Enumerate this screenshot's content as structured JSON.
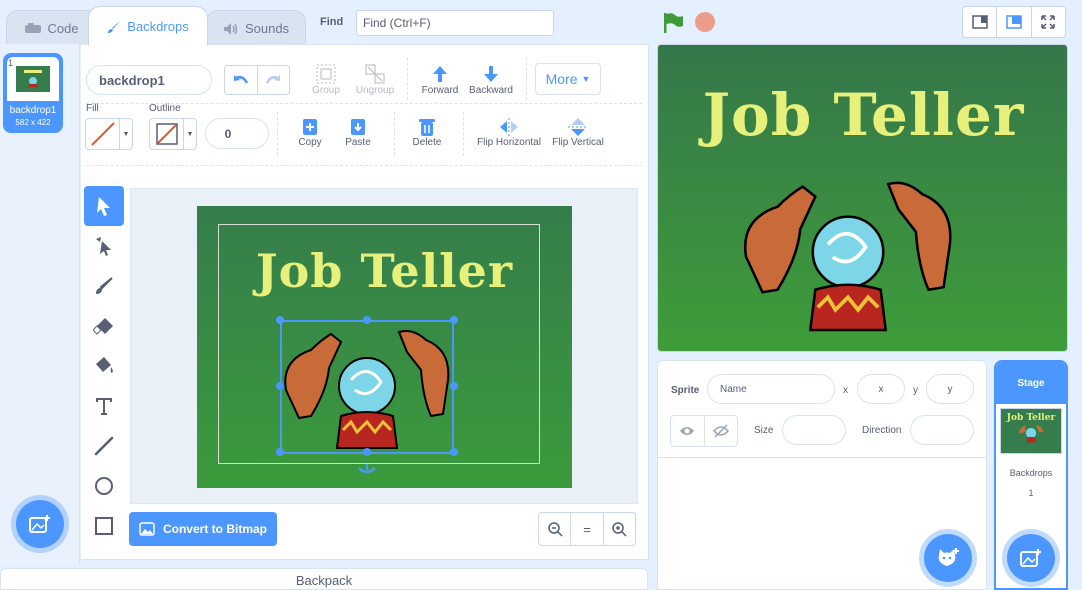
{
  "tabs": {
    "code": "Code",
    "backdrops": "Backdrops",
    "sounds": "Sounds"
  },
  "find": {
    "label": "Find",
    "placeholder": "Find (Ctrl+F)"
  },
  "backdrop_list": [
    {
      "index": "1",
      "name": "backdrop1",
      "size": "582 x 422"
    }
  ],
  "art": {
    "title": "Job Teller"
  },
  "paint": {
    "name_value": "backdrop1",
    "group": "Group",
    "ungroup": "Ungroup",
    "forward": "Forward",
    "backward": "Backward",
    "more": "More",
    "fill_label": "Fill",
    "outline_label": "Outline",
    "outline_width": "0",
    "copy": "Copy",
    "paste": "Paste",
    "delete": "Delete",
    "flip_h": "Flip Horizontal",
    "flip_v": "Flip Vertical",
    "convert": "Convert to Bitmap",
    "zoom_reset": "="
  },
  "backpack": "Backpack",
  "sprite_info": {
    "sprite_label": "Sprite",
    "name_placeholder": "Name",
    "x_label": "x",
    "x_placeholder": "x",
    "y_label": "y",
    "y_placeholder": "y",
    "size_label": "Size",
    "direction_label": "Direction"
  },
  "stage_panel": {
    "title": "Stage",
    "backdrops_label": "Backdrops",
    "backdrops_count": "1"
  },
  "colors": {
    "accent": "#4c97ff",
    "green_flag": "#3f9b3a",
    "stop": "#ec9c8a",
    "title_yellow": "#e6f07a"
  }
}
